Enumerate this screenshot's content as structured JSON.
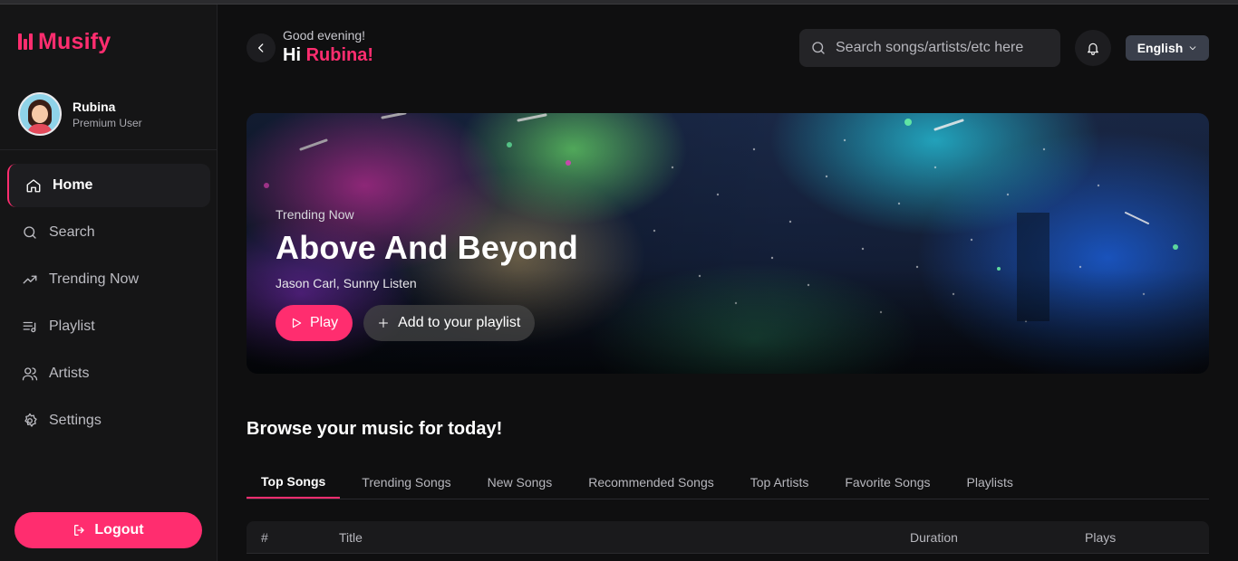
{
  "app": {
    "name": "Musify",
    "brand_color": "#ff2d6f"
  },
  "user": {
    "name": "Rubina",
    "role": "Premium User"
  },
  "nav": {
    "items": [
      {
        "label": "Home",
        "icon": "home-icon",
        "active": true
      },
      {
        "label": "Search",
        "icon": "search-icon",
        "active": false
      },
      {
        "label": "Trending Now",
        "icon": "trending-icon",
        "active": false
      },
      {
        "label": "Playlist",
        "icon": "playlist-icon",
        "active": false
      },
      {
        "label": "Artists",
        "icon": "users-icon",
        "active": false
      },
      {
        "label": "Settings",
        "icon": "gear-icon",
        "active": false
      }
    ],
    "logout_label": "Logout"
  },
  "header": {
    "greeting": "Good evening!",
    "hi": "Hi",
    "name": "Rubina!",
    "search_placeholder": "Search songs/artists/etc here",
    "language": "English"
  },
  "hero": {
    "tag": "Trending Now",
    "title": "Above And Beyond",
    "artists": "Jason Carl, Sunny Listen",
    "play_label": "Play",
    "add_label": "Add to your playlist"
  },
  "browse": {
    "title": "Browse your music for today!",
    "tabs": [
      {
        "label": "Top Songs",
        "active": true
      },
      {
        "label": "Trending Songs",
        "active": false
      },
      {
        "label": "New Songs",
        "active": false
      },
      {
        "label": "Recommended Songs",
        "active": false
      },
      {
        "label": "Top Artists",
        "active": false
      },
      {
        "label": "Favorite Songs",
        "active": false
      },
      {
        "label": "Playlists",
        "active": false
      }
    ],
    "columns": [
      "#",
      "Title",
      "Duration",
      "Plays"
    ]
  }
}
